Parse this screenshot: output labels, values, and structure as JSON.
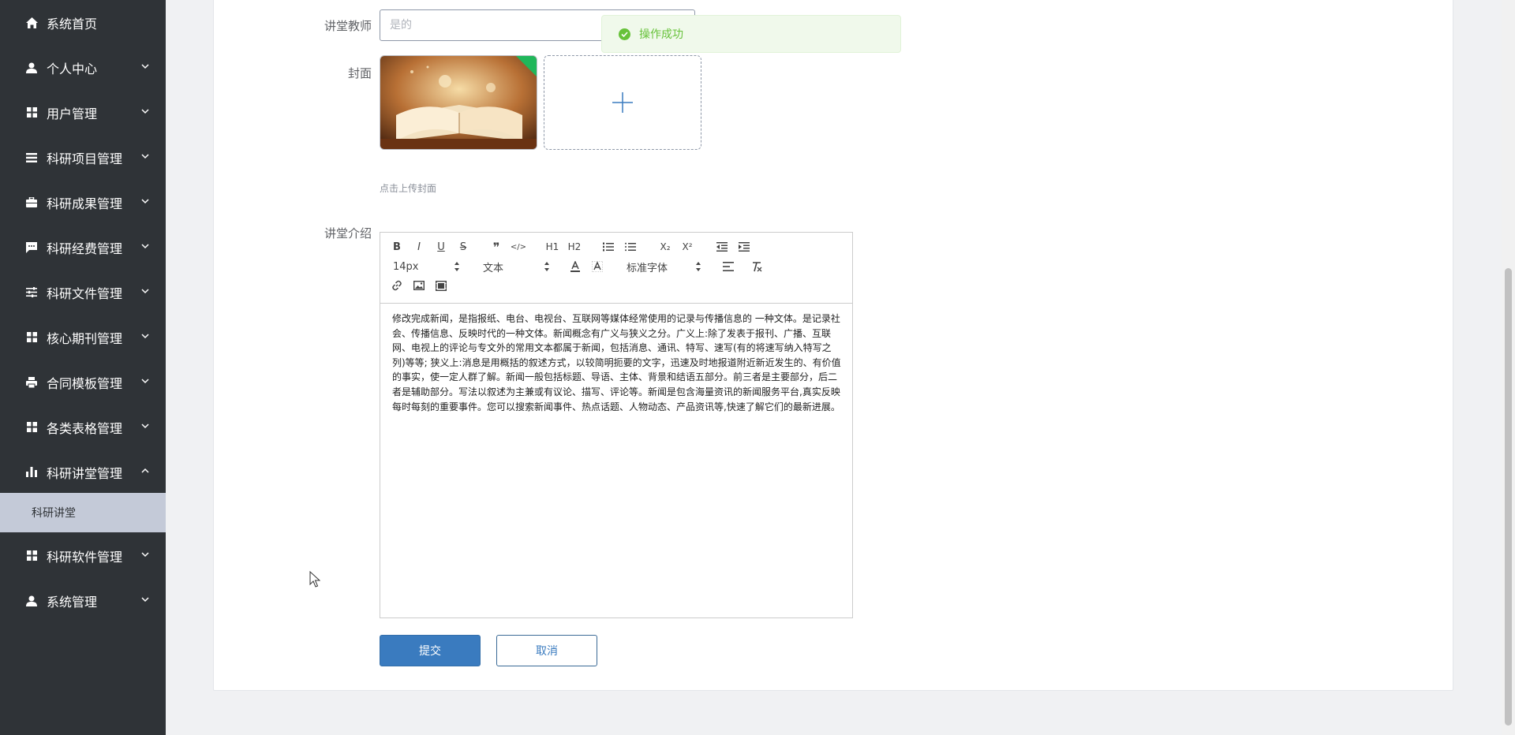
{
  "sidebar": {
    "items": [
      {
        "label": "系统首页",
        "icon": "home-icon"
      },
      {
        "label": "个人中心",
        "icon": "user-icon"
      },
      {
        "label": "用户管理",
        "icon": "grid-icon"
      },
      {
        "label": "科研项目管理",
        "icon": "list-icon"
      },
      {
        "label": "科研成果管理",
        "icon": "briefcase-icon"
      },
      {
        "label": "科研经费管理",
        "icon": "chat-icon"
      },
      {
        "label": "科研文件管理",
        "icon": "sliders-icon"
      },
      {
        "label": "核心期刊管理",
        "icon": "grid-icon"
      },
      {
        "label": "合同模板管理",
        "icon": "printer-icon"
      },
      {
        "label": "各类表格管理",
        "icon": "grid-icon"
      },
      {
        "label": "科研讲堂管理",
        "icon": "bar-chart-icon"
      },
      {
        "label": "科研软件管理",
        "icon": "grid-icon"
      },
      {
        "label": "系统管理",
        "icon": "user-icon"
      }
    ],
    "active_sub_item": "科研讲堂"
  },
  "form": {
    "teacher_label": "讲堂教师",
    "teacher_placeholder": "是的",
    "cover_label": "封面",
    "cover_hint": "点击上传封面",
    "intro_label": "讲堂介绍"
  },
  "toast": {
    "message": "操作成功",
    "color": "#67c23a"
  },
  "editor": {
    "font_size": "14px",
    "text_type": "文本",
    "font_family": "标准字体",
    "toolbar": {
      "bold": "B",
      "italic": "I",
      "underline": "U",
      "strike": "S",
      "blockquote": "❞",
      "code": "</>",
      "h1": "H1",
      "h2": "H2",
      "subscript": "X₂",
      "superscript": "X²"
    },
    "content": "修改完成新闻，是指报纸、电台、电视台、互联网等媒体经常使用的记录与传播信息的 一种文体。是记录社会、传播信息、反映时代的一种文体。新闻概念有广义与狭义之分。广义上:除了发表于报刊、广播、互联网、电视上的评论与专文外的常用文本都属于新闻，包括消息、通讯、特写、速写(有的将速写纳入特写之列)等等; 狭义上:消息是用概括的叙述方式，以较简明扼要的文字，迅速及时地报道附近新近发生的、有价值的事实，使一定人群了解。新闻一般包括标题、导语、主体、背景和结语五部分。前三者是主要部分，后二者是辅助部分。写法以叙述为主兼或有议论、描写、评论等。新闻是包含海量资讯的新闻服务平台,真实反映每时每刻的重要事件。您可以搜索新闻事件、热点话题、人物动态、产品资讯等,快速了解它们的最新进展。"
  },
  "buttons": {
    "submit": "提交",
    "cancel": "取消"
  },
  "colors": {
    "sidebar_bg": "#2f3337",
    "active_sub_bg": "#c4cad8",
    "primary": "#3a7bbf"
  }
}
